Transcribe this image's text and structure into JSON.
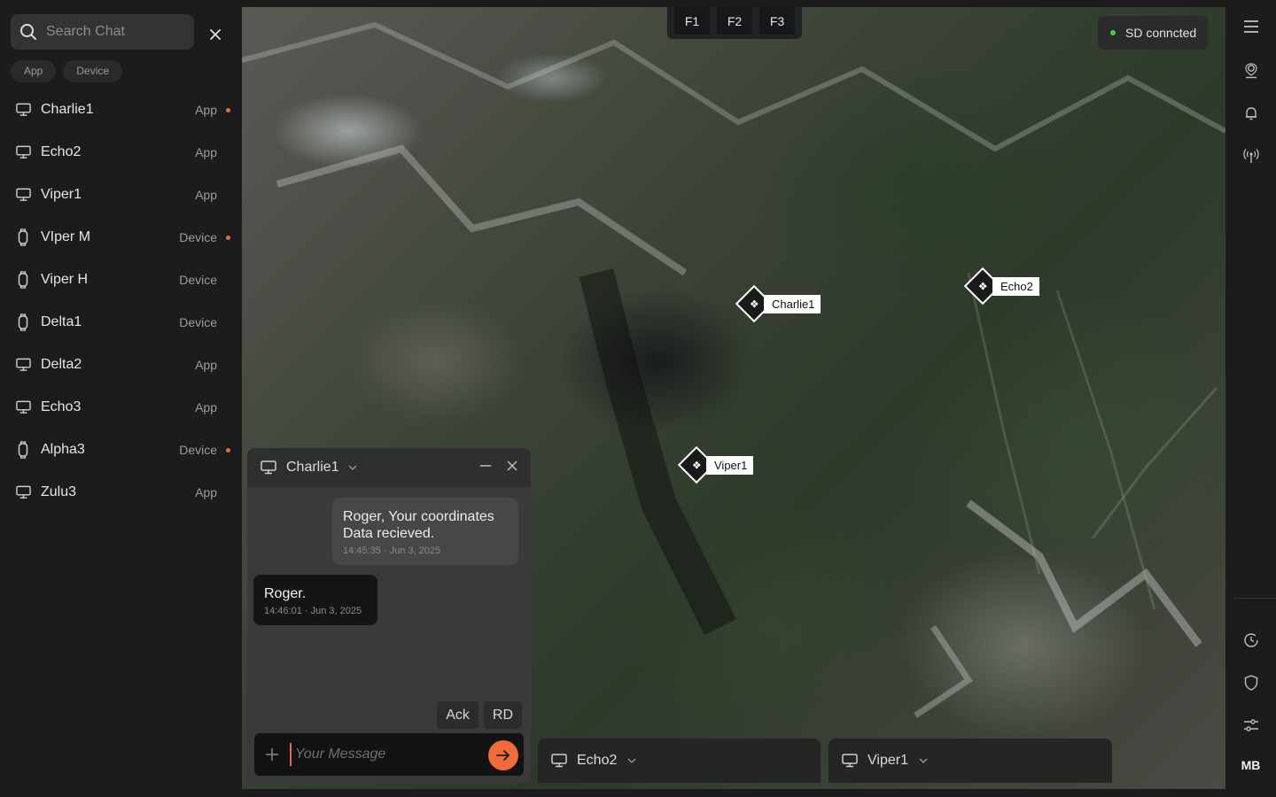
{
  "search": {
    "placeholder": "Search Chat"
  },
  "filters": [
    "App",
    "Device"
  ],
  "chats": [
    {
      "name": "Charlie1",
      "type": "App",
      "kind": "monitor",
      "unread": true
    },
    {
      "name": "Echo2",
      "type": "App",
      "kind": "monitor",
      "unread": false
    },
    {
      "name": "Viper1",
      "type": "App",
      "kind": "monitor",
      "unread": false
    },
    {
      "name": "VIper M",
      "type": "Device",
      "kind": "watch",
      "unread": true
    },
    {
      "name": "Viper H",
      "type": "Device",
      "kind": "watch",
      "unread": false
    },
    {
      "name": "Delta1",
      "type": "Device",
      "kind": "watch",
      "unread": false
    },
    {
      "name": "Delta2",
      "type": "App",
      "kind": "monitor",
      "unread": false
    },
    {
      "name": "Echo3",
      "type": "App",
      "kind": "monitor",
      "unread": false
    },
    {
      "name": "Alpha3",
      "type": "Device",
      "kind": "watch",
      "unread": true
    },
    {
      "name": "Zulu3",
      "type": "App",
      "kind": "monitor",
      "unread": false
    }
  ],
  "fkeys": [
    "F1",
    "F2",
    "F3"
  ],
  "status": {
    "label": "SD conncted",
    "color": "#3fcf4a"
  },
  "markers": {
    "charlie": "Charlie1",
    "echo": "Echo2",
    "viper": "Viper1"
  },
  "chat_window": {
    "title": "Charlie1",
    "messages": [
      {
        "dir": "out",
        "text": "Roger, Your coordinates Data recieved.",
        "time": "14:45:35 · Jun 3, 2025"
      },
      {
        "dir": "in",
        "text": "Roger.",
        "time": "14:46:01 · Jun 3, 2025"
      }
    ],
    "quick_replies": [
      "Ack",
      "RD"
    ],
    "input_placeholder": "Your Message"
  },
  "minimized_chats": [
    "Echo2",
    "Viper1"
  ],
  "user_initials": "MB",
  "accent": "#f06a3a"
}
